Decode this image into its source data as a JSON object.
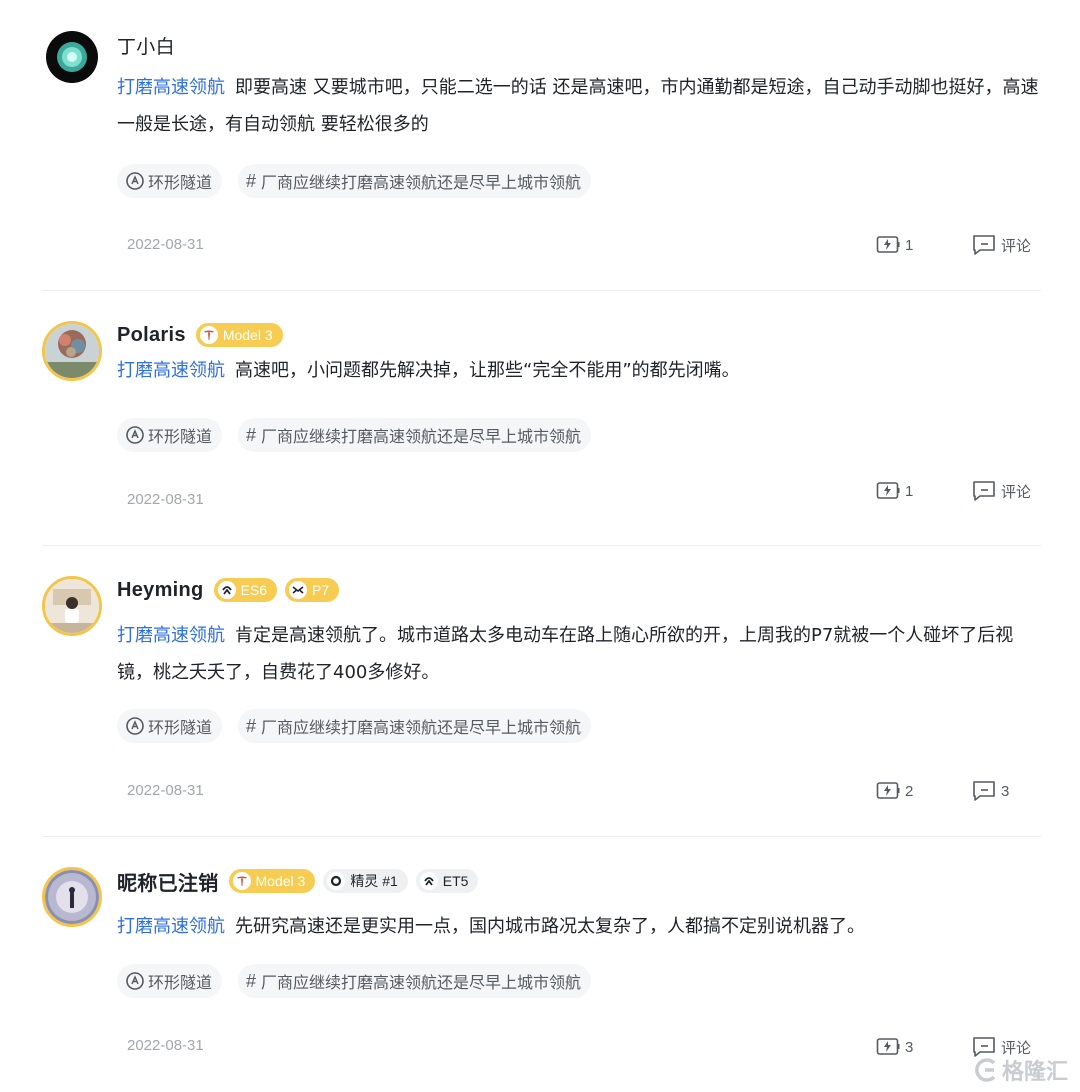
{
  "posts": [
    {
      "username": "丁小白",
      "badges": [],
      "topic": "打磨高速领航",
      "text": "即要高速 又要城市吧，只能二选一的话 还是高速吧，市内通勤都是短途，自己动手动脚也挺好，高速一般是长途，有自动领航 要轻松很多的",
      "tags": [
        "环形隧道",
        "厂商应继续打磨高速领航还是尽早上城市领航"
      ],
      "date": "2022-08-31",
      "charge_count": "1",
      "comment_label": "评论"
    },
    {
      "username": "Polaris",
      "badges": [
        {
          "label": "Model 3",
          "style": "gold",
          "icon": "tesla-icon"
        }
      ],
      "topic": "打磨高速领航",
      "text": "高速吧，小问题都先解决掉，让那些“完全不能用”的都先闭嘴。",
      "tags": [
        "环形隧道",
        "厂商应继续打磨高速领航还是尽早上城市领航"
      ],
      "date": "2022-08-31",
      "charge_count": "1",
      "comment_label": "评论"
    },
    {
      "username": "Heyming",
      "badges": [
        {
          "label": "ES6",
          "style": "gold",
          "icon": "nio-icon"
        },
        {
          "label": "P7",
          "style": "gold",
          "icon": "xpeng-icon"
        }
      ],
      "topic": "打磨高速领航",
      "text": "肯定是高速领航了。城市道路太多电动车在路上随心所欲的开，上周我的P7就被一个人碰坏了后视镜，桃之夭夭了，自费花了400多修好。",
      "tags": [
        "环形隧道",
        "厂商应继续打磨高速领航还是尽早上城市领航"
      ],
      "date": "2022-08-31",
      "charge_count": "2",
      "comment_label": "3"
    },
    {
      "username": "昵称已注销",
      "badges": [
        {
          "label": "Model 3",
          "style": "gold",
          "icon": "tesla-icon"
        },
        {
          "label": "精灵 #1",
          "style": "gray",
          "icon": "smart-icon"
        },
        {
          "label": "ET5",
          "style": "gray",
          "icon": "nio-icon"
        }
      ],
      "topic": "打磨高速领航",
      "text": "先研究高速还是更实用一点，国内城市路况太复杂了，人都搞不定别说机器了。",
      "tags": [
        "环形隧道",
        "厂商应继续打磨高速领航还是尽早上城市领航"
      ],
      "date": "2022-08-31",
      "charge_count": "3",
      "comment_label": "评论"
    }
  ],
  "watermark": "格隆汇",
  "colors": {
    "topic": "#2f6fe0",
    "badge_gold": "#f7cc52",
    "tag_bg": "#f5f6f8",
    "date": "#a2a7ad"
  }
}
